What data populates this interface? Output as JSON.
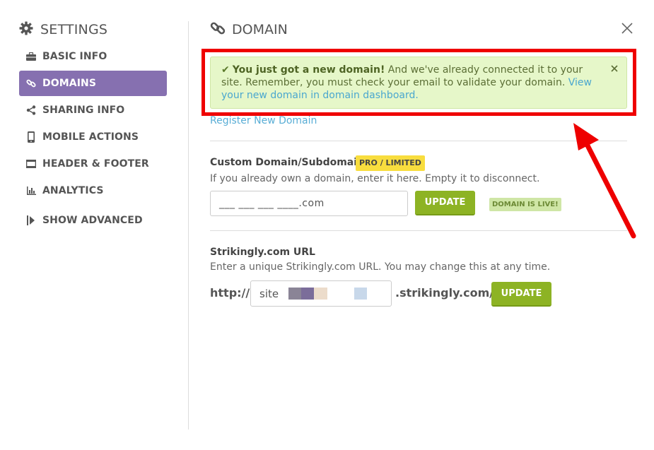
{
  "sidebar": {
    "title": "SETTINGS",
    "title_icon": "gear-icon",
    "items": [
      {
        "label": "BASIC INFO",
        "icon": "briefcase-icon",
        "active": false
      },
      {
        "label": "DOMAINS",
        "icon": "link-icon",
        "active": true
      },
      {
        "label": "SHARING INFO",
        "icon": "share-icon",
        "active": false
      },
      {
        "label": "MOBILE ACTIONS",
        "icon": "mobile-icon",
        "active": false
      },
      {
        "label": "HEADER & FOOTER",
        "icon": "header-footer-icon",
        "active": false
      },
      {
        "label": "ANALYTICS",
        "icon": "bar-chart-icon",
        "active": false
      },
      {
        "label": "SHOW ADVANCED",
        "icon": "play-step-icon",
        "active": false
      }
    ]
  },
  "main": {
    "title": "DOMAIN",
    "title_icon": "link-icon"
  },
  "alert": {
    "strong": "You just got a new domain!",
    "text": " And we've already connected it to your site. Remember, you must check your email to validate your domain. ",
    "link": "View your new domain in domain dashboard."
  },
  "register_link": "Register New Domain",
  "custom_domain": {
    "heading": "Custom Domain/Subdomain",
    "badge": "PRO / LIMITED",
    "help": "If you already own a domain, enter it here. Empty it to disconnect.",
    "input_value": "___ ___ ___ ____.com",
    "button": "UPDATE",
    "status": "DOMAIN IS LIVE!"
  },
  "strikingly_url": {
    "heading": "Strikingly.com URL",
    "help": "Enter a unique Strikingly.com URL. You may change this at any time.",
    "prefix": "http://",
    "input_value": "site",
    "suffix": ".strikingly.com/",
    "button": "UPDATE"
  },
  "colors": {
    "accent_purple": "#8670b0",
    "update_green": "#8db324",
    "alert_bg": "#e6f7c9",
    "highlight_red": "#ef0000",
    "link_blue": "#5aaed6",
    "pro_yellow": "#f8dd3e"
  }
}
